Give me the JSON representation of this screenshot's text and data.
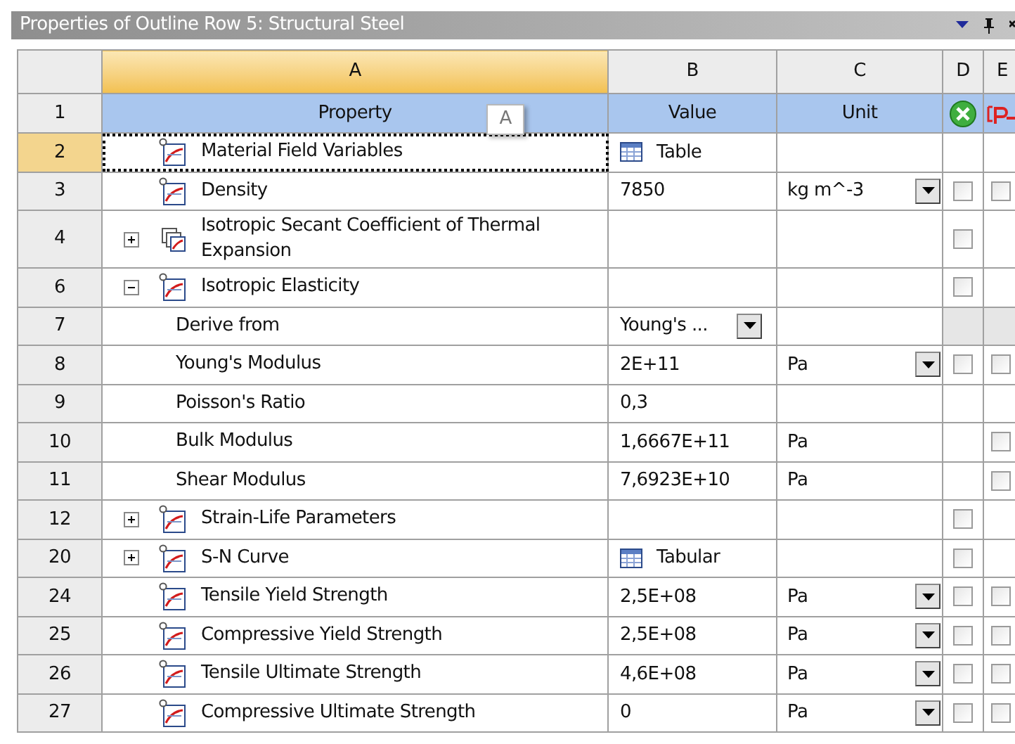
{
  "panel": {
    "title": "Properties of Outline Row 5: Structural Steel"
  },
  "columns": [
    {
      "label": "A",
      "selected": true
    },
    {
      "label": "B",
      "selected": false
    },
    {
      "label": "C",
      "selected": false
    },
    {
      "label": "D",
      "selected": false
    },
    {
      "label": "E",
      "selected": false
    }
  ],
  "header_row": {
    "number": "1",
    "property": "Property",
    "value": "Value",
    "unit": "Unit"
  },
  "drag_tip": "A",
  "rows": [
    {
      "number": "2",
      "selected": true,
      "kind": "curve",
      "property": "Material Field Variables",
      "value": {
        "kind": "table",
        "text": "Table"
      },
      "disabled": false
    },
    {
      "number": "3",
      "selected": false,
      "kind": "curve",
      "property": "Density",
      "value": {
        "kind": "text",
        "text": "7850"
      },
      "unit": "kg m^-3",
      "unit_dropdown": true,
      "d": {
        "checked": false
      },
      "e": {
        "checked": false
      },
      "disabled": false
    },
    {
      "number": "4",
      "selected": false,
      "kind": "group",
      "expanded": false,
      "property": "Isotropic Secant Coefficient of Thermal Expansion",
      "d": {
        "checked": false
      },
      "disabled": false
    },
    {
      "number": "6",
      "selected": false,
      "kind": "curve",
      "expanded": true,
      "property": "Isotropic Elasticity",
      "d": {
        "checked": false
      },
      "disabled": false
    },
    {
      "number": "7",
      "selected": false,
      "kind": "sub",
      "property": "Derive from",
      "value": {
        "kind": "text",
        "text": "Young's ..."
      },
      "value_dropdown": true,
      "disabled": true
    },
    {
      "number": "8",
      "selected": false,
      "kind": "sub",
      "property": "Young's Modulus",
      "value": {
        "kind": "text",
        "text": "2E+11"
      },
      "unit": "Pa",
      "unit_dropdown": true,
      "d": {
        "checked": false
      },
      "e": {
        "checked": false
      },
      "disabled": false
    },
    {
      "number": "9",
      "selected": false,
      "kind": "sub",
      "property": "Poisson's Ratio",
      "value": {
        "kind": "text",
        "text": "0,3"
      },
      "disabled": false
    },
    {
      "number": "10",
      "selected": false,
      "kind": "sub",
      "property": "Bulk Modulus",
      "value": {
        "kind": "text",
        "text": "1,6667E+11"
      },
      "unit": "Pa",
      "e": {
        "checked": false
      },
      "disabled": false
    },
    {
      "number": "11",
      "selected": false,
      "kind": "sub",
      "property": "Shear Modulus",
      "value": {
        "kind": "text",
        "text": "7,6923E+10"
      },
      "unit": "Pa",
      "e": {
        "checked": false
      },
      "disabled": false
    },
    {
      "number": "12",
      "selected": false,
      "kind": "curve",
      "expanded": false,
      "property": "Strain-Life Parameters",
      "d": {
        "checked": false
      },
      "disabled": false
    },
    {
      "number": "20",
      "selected": false,
      "kind": "curve",
      "expanded": false,
      "property": "S-N Curve",
      "value": {
        "kind": "table",
        "text": "Tabular"
      },
      "d": {
        "checked": false
      },
      "disabled": false
    },
    {
      "number": "24",
      "selected": false,
      "kind": "curve",
      "property": "Tensile Yield Strength",
      "value": {
        "kind": "text",
        "text": "2,5E+08"
      },
      "unit": "Pa",
      "unit_dropdown": true,
      "d": {
        "checked": false
      },
      "e": {
        "checked": false
      },
      "disabled": false
    },
    {
      "number": "25",
      "selected": false,
      "kind": "curve",
      "property": "Compressive Yield Strength",
      "value": {
        "kind": "text",
        "text": "2,5E+08"
      },
      "unit": "Pa",
      "unit_dropdown": true,
      "d": {
        "checked": false
      },
      "e": {
        "checked": false
      },
      "disabled": false
    },
    {
      "number": "26",
      "selected": false,
      "kind": "curve",
      "property": "Tensile Ultimate Strength",
      "value": {
        "kind": "text",
        "text": "4,6E+08"
      },
      "unit": "Pa",
      "unit_dropdown": true,
      "d": {
        "checked": false
      },
      "e": {
        "checked": false
      },
      "disabled": false
    },
    {
      "number": "27",
      "selected": false,
      "kind": "curve",
      "property": "Compressive Ultimate Strength",
      "value": {
        "kind": "text",
        "text": "0"
      },
      "unit": "Pa",
      "unit_dropdown": true,
      "d": {
        "checked": false
      },
      "e": {
        "checked": false
      },
      "disabled": false
    }
  ]
}
